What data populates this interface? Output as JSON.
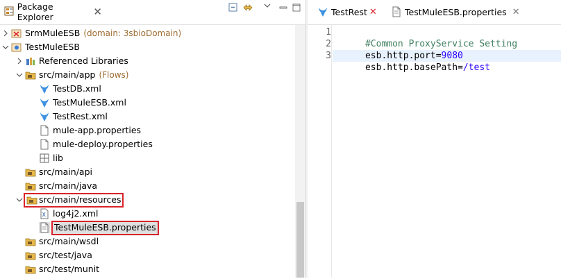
{
  "explorer": {
    "title": "Package Explorer",
    "close": "✕"
  },
  "tree": {
    "items": [
      {
        "label": "SrmMuleESB",
        "decoration": "(domain: 3sbioDomain)"
      },
      {
        "label": "TestMuleESB"
      },
      {
        "label": "Referenced Libraries"
      },
      {
        "label": "src/main/app",
        "decoration": "(Flows)"
      },
      {
        "label": "TestDB.xml"
      },
      {
        "label": "TestMuleESB.xml"
      },
      {
        "label": "TestRest.xml"
      },
      {
        "label": "mule-app.properties"
      },
      {
        "label": "mule-deploy.properties"
      },
      {
        "label": "lib"
      },
      {
        "label": "src/main/api"
      },
      {
        "label": "src/main/java"
      },
      {
        "label": "src/main/resources"
      },
      {
        "label": "log4j2.xml"
      },
      {
        "label": "TestMuleESB.properties"
      },
      {
        "label": "src/main/wsdl"
      },
      {
        "label": "src/test/java"
      },
      {
        "label": "src/test/munit"
      }
    ]
  },
  "editor": {
    "tabs": [
      {
        "label": "TestRest",
        "close": "✕"
      },
      {
        "label": "TestMuleESB.properties",
        "close": "✕"
      }
    ],
    "line_numbers": [
      "1",
      "2",
      "3"
    ],
    "lines": [
      {
        "comment": "#Common ProxyService Setting"
      },
      {
        "key": "esb.http.port=",
        "value": "9080"
      },
      {
        "key": "esb.http.basePath=",
        "value": "/test"
      }
    ]
  },
  "colors": {
    "highlight_box": "#d9232a",
    "comment": "#3f7f5f",
    "value": "#2a00ff",
    "decoration": "#9c6b30"
  }
}
